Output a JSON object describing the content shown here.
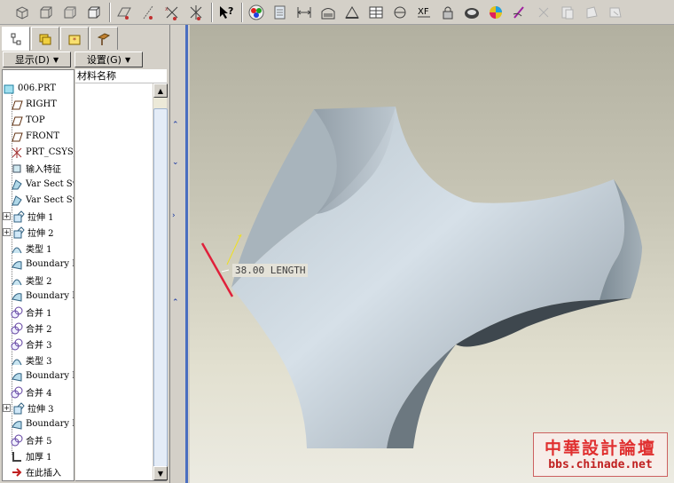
{
  "toolbar": {
    "icons": [
      "view-iso-icon",
      "view-box-icon",
      "view-wire-icon",
      "view-shade-icon",
      "layer-icon",
      "datum-plane-icon",
      "datum-axis-icon",
      "csys-icon",
      "help-query-icon",
      "color-icon",
      "sheet-icon",
      "dimension-icon",
      "section-icon",
      "plane-icon",
      "table-icon",
      "theta-icon",
      "xf-icon",
      "lock-icon",
      "print-icon",
      "appearance-icon",
      "edit-icon",
      "cut-icon",
      "copy-icon",
      "paste-icon"
    ]
  },
  "panel": {
    "tabs": [
      "model-tree-tab",
      "layer-tab",
      "favorites-tab",
      "tools-tab"
    ],
    "show_menu": "显示(D)",
    "settings_menu": "设置(G)",
    "column_header": "材料名称"
  },
  "tree": {
    "items": [
      {
        "label": "006.PRT",
        "icon": "part-icon",
        "expand": ""
      },
      {
        "label": "RIGHT",
        "icon": "datum-plane-icon",
        "expand": ""
      },
      {
        "label": "TOP",
        "icon": "datum-plane-icon",
        "expand": ""
      },
      {
        "label": "FRONT",
        "icon": "datum-plane-icon",
        "expand": ""
      },
      {
        "label": "PRT_CSYS_DEF",
        "icon": "csys-icon",
        "expand": ""
      },
      {
        "label": "输入特征",
        "icon": "import-icon",
        "expand": ""
      },
      {
        "label": "Var Sect Sweep",
        "icon": "sweep-icon",
        "expand": ""
      },
      {
        "label": "Var Sect Sweep",
        "icon": "sweep-icon",
        "expand": ""
      },
      {
        "label": "拉伸 1",
        "icon": "extrude-icon",
        "expand": "+"
      },
      {
        "label": "拉伸 2",
        "icon": "extrude-icon",
        "expand": "+"
      },
      {
        "label": "类型 1",
        "icon": "surface-icon",
        "expand": ""
      },
      {
        "label": "Boundary Blend",
        "icon": "boundary-icon",
        "expand": ""
      },
      {
        "label": "类型 2",
        "icon": "surface-icon",
        "expand": ""
      },
      {
        "label": "Boundary Blend",
        "icon": "boundary-icon",
        "expand": ""
      },
      {
        "label": "合并 1",
        "icon": "merge-icon",
        "expand": ""
      },
      {
        "label": "合并 2",
        "icon": "merge-icon",
        "expand": ""
      },
      {
        "label": "合并 3",
        "icon": "merge-icon",
        "expand": ""
      },
      {
        "label": "类型 3",
        "icon": "surface-icon",
        "expand": ""
      },
      {
        "label": "Boundary Blend",
        "icon": "boundary-icon",
        "expand": ""
      },
      {
        "label": "合并 4",
        "icon": "merge-icon",
        "expand": ""
      },
      {
        "label": "拉伸 3",
        "icon": "extrude-icon",
        "expand": "+"
      },
      {
        "label": "Boundary Blend",
        "icon": "boundary-icon",
        "expand": ""
      },
      {
        "label": "合并 5",
        "icon": "merge-icon",
        "expand": ""
      },
      {
        "label": "加厚 1",
        "icon": "thicken-icon",
        "expand": ""
      },
      {
        "label": "在此插入",
        "icon": "insert-here-icon",
        "expand": ""
      }
    ]
  },
  "viewport": {
    "dimension_label": "38.00 LENGTH"
  },
  "watermark": {
    "title": "中華設計論壇",
    "url": "bbs.chinade.net"
  },
  "colors": {
    "accent": "#4a6ec0",
    "highlight_edge": "#e0203a",
    "dim_yellow": "#f0e020"
  }
}
